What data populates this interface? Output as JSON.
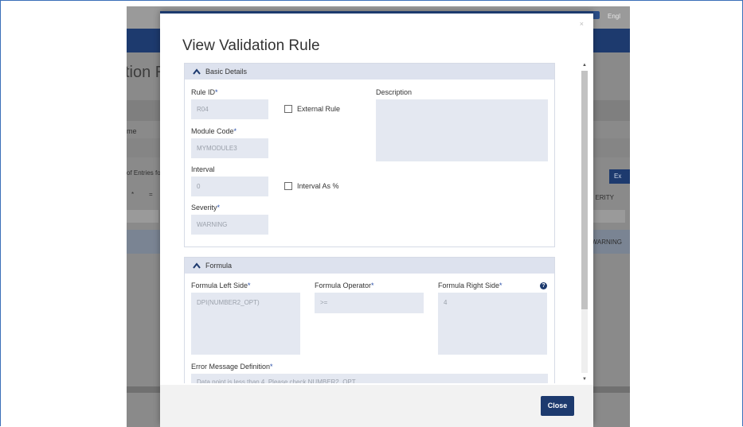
{
  "background": {
    "title": "tion Ru",
    "language": "Engl",
    "column_label": "me",
    "entries_text": "of Entries fou",
    "severity_col": "ERITY",
    "export_btn": "Ex",
    "row_severity": "WARNING",
    "filter_ops": [
      "*",
      "="
    ]
  },
  "modal": {
    "title": "View Validation Rule",
    "close_x": "×",
    "basic": {
      "header": "Basic Details",
      "rule_id_label": "Rule ID",
      "rule_id_value": "R04",
      "external_rule_label": "External Rule",
      "external_rule_checked": false,
      "description_label": "Description",
      "description_value": "",
      "module_code_label": "Module Code",
      "module_code_value": "MYMODULE3",
      "interval_label": "Interval",
      "interval_value": "0",
      "interval_pct_label": "Interval As %",
      "interval_pct_checked": false,
      "severity_label": "Severity",
      "severity_value": "WARNING",
      "required_mark": "*"
    },
    "formula": {
      "header": "Formula",
      "left_label": "Formula Left Side",
      "left_value": "DPI(NUMBER2_OPT)",
      "operator_label": "Formula Operator",
      "operator_value": ">=",
      "right_label": "Formula Right Side",
      "right_value": "4",
      "help_icon": "?",
      "error_label": "Error Message Definition",
      "error_value": "Data point is less than 4. Please check NUMBER2_OPT"
    },
    "footer": {
      "close_label": "Close"
    }
  },
  "colors": {
    "primary": "#1d3a6e",
    "section_header": "#dde2ee",
    "field_bg": "#e4e8f1",
    "required": "#2a4fa8"
  }
}
